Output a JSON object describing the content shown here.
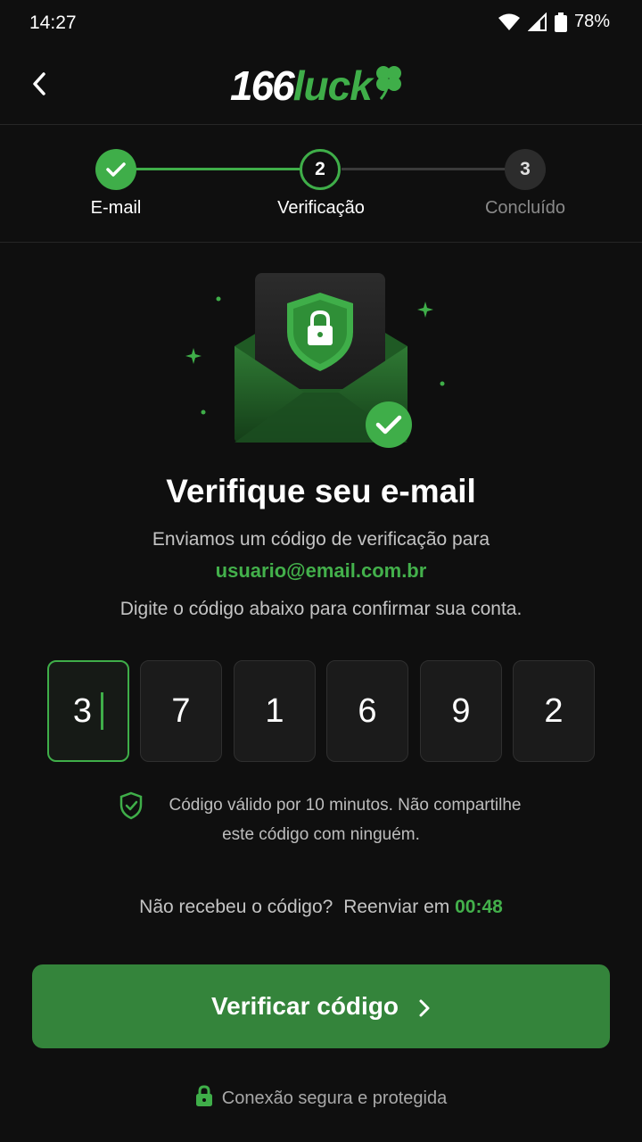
{
  "status_bar": {
    "time": "14:27",
    "battery": "78%"
  },
  "header": {
    "logo_number": "166",
    "logo_word": "luck"
  },
  "stepper": {
    "steps": [
      {
        "label": "E-mail",
        "state": "done"
      },
      {
        "label": "Verificação",
        "number": "2",
        "state": "current"
      },
      {
        "label": "Concluído",
        "number": "3",
        "state": "upcoming"
      }
    ]
  },
  "content": {
    "title": "Verifique seu e-mail",
    "subtitle_line1": "Enviamos um código de verificação para",
    "email": "usuario@email.com.br",
    "subtitle_line2": "Digite o código abaixo para confirmar sua conta."
  },
  "code": {
    "digits": [
      "3",
      "7",
      "1",
      "6",
      "9",
      "2"
    ]
  },
  "validity": {
    "line1": "Código válido por 10 minutos. Não compartilhe",
    "line2": "este código com ninguém."
  },
  "resend": {
    "question": "Não recebeu o código?",
    "label": "Reenviar em",
    "timer": "00:48"
  },
  "button": {
    "label": "Verificar código"
  },
  "footer": {
    "secure_text": "Conexão segura e protegida"
  },
  "colors": {
    "accent": "#3fae49",
    "button": "#34843b",
    "background": "#0f0f0f"
  }
}
